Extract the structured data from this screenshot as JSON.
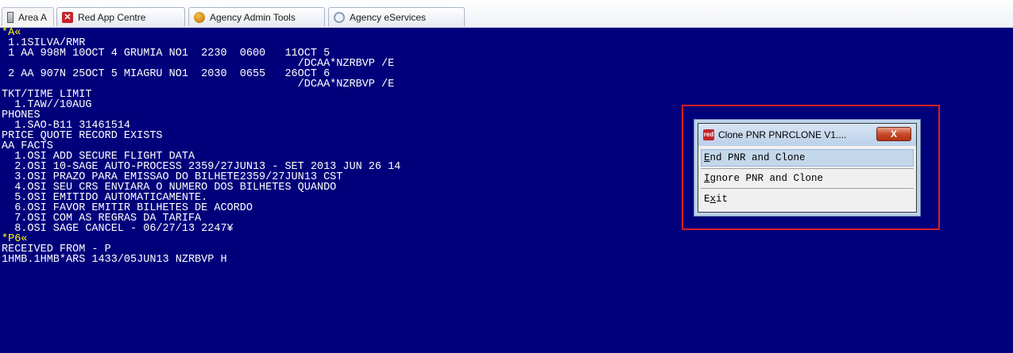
{
  "tabs": [
    {
      "label": "Area A",
      "icon": "terminal-icon",
      "active": true
    },
    {
      "label": "Red App Centre",
      "icon": "red-app-icon",
      "active": false
    },
    {
      "label": "Agency Admin Tools",
      "icon": "admin-tools-icon",
      "active": false
    },
    {
      "label": "Agency eServices",
      "icon": "eservices-icon",
      "active": false
    }
  ],
  "terminal": {
    "lines": [
      {
        "text": "*A«",
        "marker": true
      },
      {
        "text": " 1.1SILVA/RMR"
      },
      {
        "text": " 1 AA 998M 10OCT 4 GRUMIA NO1  2230  0600   11OCT 5"
      },
      {
        "text": "                                              /DCAA*NZRBVP /E"
      },
      {
        "text": " 2 AA 907N 25OCT 5 MIAGRU NO1  2030  0655   26OCT 6"
      },
      {
        "text": "                                              /DCAA*NZRBVP /E"
      },
      {
        "text": "TKT/TIME LIMIT"
      },
      {
        "text": "  1.TAW//10AUG"
      },
      {
        "text": "PHONES"
      },
      {
        "text": "  1.SAO-B11 31461514"
      },
      {
        "text": "PRICE QUOTE RECORD EXISTS"
      },
      {
        "text": "AA FACTS"
      },
      {
        "text": "  1.OSI ADD SECURE FLIGHT DATA"
      },
      {
        "text": "  2.OSI 10-SAGE AUTO-PROCESS 2359/27JUN13 - SET 2013 JUN 26 14"
      },
      {
        "text": "  3.OSI PRAZO PARA EMISSAO DO BILHETE2359/27JUN13 CST"
      },
      {
        "text": "  4.OSI SEU CRS ENVIARA O NUMERO DOS BILHETES QUANDO"
      },
      {
        "text": "  5.OSI EMITIDO AUTOMATICAMENTE."
      },
      {
        "text": "  6.OSI FAVOR EMITIR BILHETES DE ACORDO"
      },
      {
        "text": "  7.OSI COM AS REGRAS DA TARIFA"
      },
      {
        "text": "  8.OSI SAGE CANCEL - 06/27/13 2247¥"
      },
      {
        "text": "*P6«",
        "marker": true
      },
      {
        "text": "RECEIVED FROM - P"
      },
      {
        "text": "1HMB.1HMB*ARS 1433/05JUN13 NZRBVP H"
      }
    ]
  },
  "popup": {
    "icon_text": "red",
    "title": "Clone PNR  PNRCLONE V1....",
    "close_label": "X",
    "menu": {
      "end": {
        "key": "E",
        "rest": "nd PNR and Clone"
      },
      "ignore": {
        "key": "I",
        "rest": "gnore PNR and Clone"
      },
      "exit": {
        "pre": "E",
        "key": "x",
        "rest": "it"
      }
    }
  },
  "colors": {
    "terminal_bg": "#00007b",
    "terminal_text": "#ffffff",
    "marker_text": "#ffff00",
    "highlight": "#d42020"
  }
}
